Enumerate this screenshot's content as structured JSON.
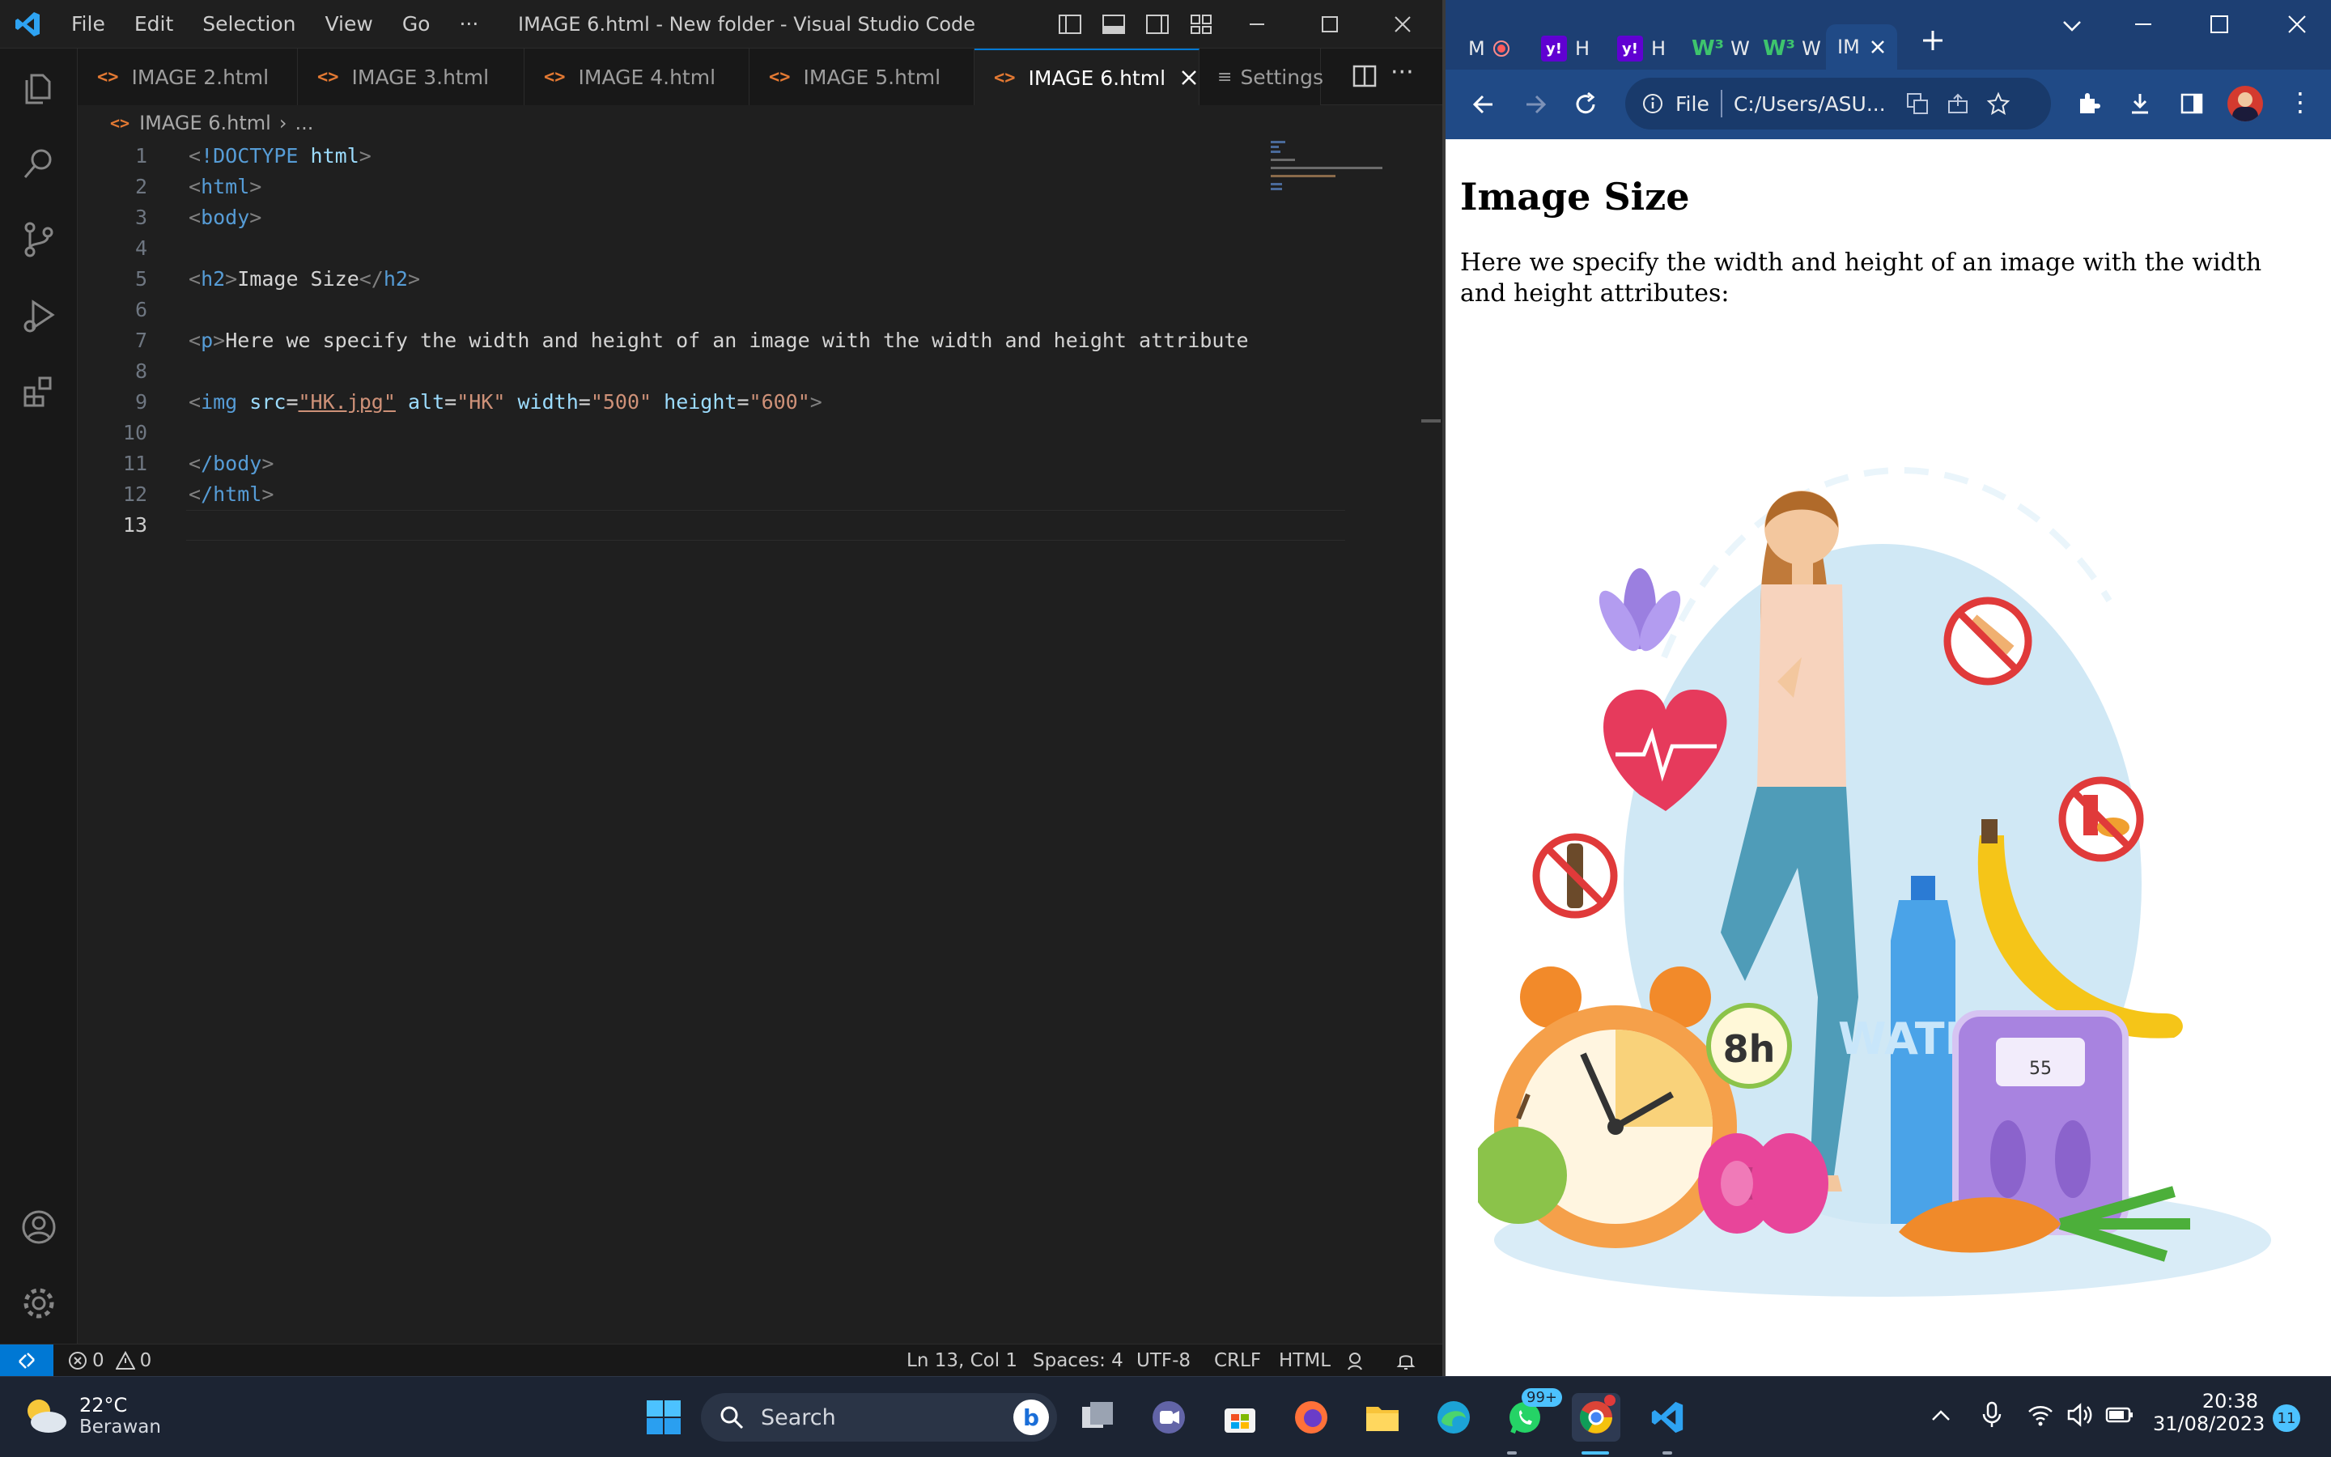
{
  "vscode": {
    "menus": [
      "File",
      "Edit",
      "Selection",
      "View",
      "Go"
    ],
    "more_menu": "···",
    "window_title": "IMAGE 6.html - New folder - Visual Studio Code",
    "tabs": [
      {
        "label": "IMAGE 2.html"
      },
      {
        "label": "IMAGE 3.html"
      },
      {
        "label": "IMAGE 4.html"
      },
      {
        "label": "IMAGE 5.html"
      },
      {
        "label": "IMAGE 6.html",
        "active": true
      }
    ],
    "settings_tab": "Settings",
    "breadcrumb": {
      "file": "IMAGE 6.html",
      "more": "..."
    },
    "code_lines": [
      {
        "n": "1"
      },
      {
        "n": "2"
      },
      {
        "n": "3"
      },
      {
        "n": "4"
      },
      {
        "n": "5"
      },
      {
        "n": "6"
      },
      {
        "n": "7"
      },
      {
        "n": "8"
      },
      {
        "n": "9"
      },
      {
        "n": "10"
      },
      {
        "n": "11"
      },
      {
        "n": "12"
      },
      {
        "n": "13"
      }
    ],
    "code": {
      "l1_doctype": "!DOCTYPE",
      "l1_html": "html",
      "l2": "html",
      "l3": "body",
      "l5_tag": "h2",
      "l5_text": "Image Size",
      "l7_tag": "p",
      "l7_text": "Here we specify the width and height of an image with the width and height attribute",
      "l9_tag": "img",
      "l9_src_attr": "src",
      "l9_src_val": "\"HK.jpg\"",
      "l9_alt_attr": "alt",
      "l9_alt_val": "\"HK\"",
      "l9_width_attr": "width",
      "l9_width_val": "\"500\"",
      "l9_height_attr": "height",
      "l9_height_val": "\"600\"",
      "l11": "/body",
      "l12": "/html"
    },
    "status": {
      "errors": "0",
      "warnings": "0",
      "position": "Ln 13, Col 1",
      "spaces": "Spaces: 4",
      "encoding": "UTF-8",
      "eol": "CRLF",
      "language": "HTML"
    }
  },
  "chrome": {
    "tabs": [
      "M",
      "H",
      "H",
      "W",
      "W",
      "IM"
    ],
    "address_scheme": "File",
    "address": "C:/Users/ASU...",
    "page_heading": "Image Size",
    "page_paragraph": "Here we specify the width and height of an image with the width and height attributes:"
  },
  "taskbar": {
    "weather_temp": "22°C",
    "weather_desc": "Berawan",
    "search_placeholder": "Search",
    "whatsapp_badge": "99+",
    "time": "20:38",
    "date": "31/08/2023",
    "notification_count": "11",
    "illustration_labels": {
      "clock": "8h",
      "water": "WATER",
      "scale": "55"
    }
  }
}
